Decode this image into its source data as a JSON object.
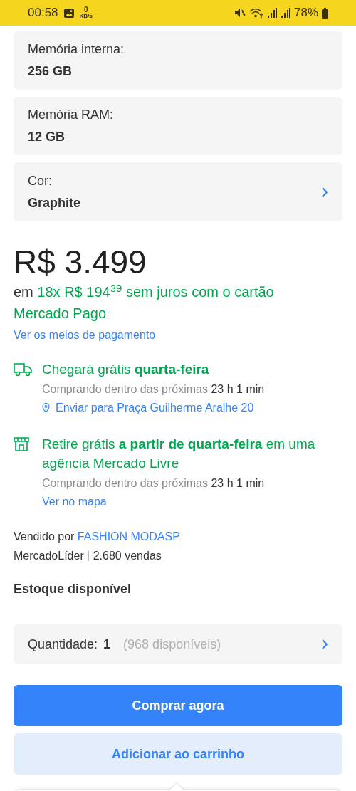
{
  "status_bar": {
    "time": "00:58",
    "speed_value": "0",
    "speed_unit": "KB/s",
    "battery": "78%"
  },
  "specs": [
    {
      "kind": "info",
      "label": "Memória interna:",
      "value": "256 GB"
    },
    {
      "kind": "info",
      "label": "Memória RAM:",
      "value": "12 GB"
    },
    {
      "kind": "select",
      "label": "Cor:",
      "value": "Graphite"
    }
  ],
  "price": "R$ 3.499",
  "installments": {
    "prefix": "em",
    "text": "18x R$ 194$^{39}$ sem juros com o cartão Mercado Pago"
  },
  "payment_link": "Ver os meios de pagamento",
  "delivery": [
    {
      "kind": "shipping",
      "title": "Chegará grátis **quarta-feira**",
      "note": "Comprando dentro das próximas",
      "time": "23 h 1 min",
      "link": "Enviar para Praça Guilherme Aralhe 20"
    },
    {
      "kind": "pickup",
      "title": "Retire grátis **a partir de quarta-feira** em uma agência Mercado Livre",
      "note": "Comprando dentro das próximas",
      "time": "23 h 1 min",
      "link": "Ver no mapa"
    }
  ],
  "seller": {
    "prefix": "Vendido por",
    "name": "FASHION MODASP",
    "badge": "MercadoLíder",
    "sales": "2.680 vendas"
  },
  "stock_title": "Estoque disponível",
  "quantity": {
    "label": "Quantidade:",
    "value": "1",
    "available": "(968 disponíveis)"
  },
  "buttons": [
    {
      "kind": "primary",
      "label": "Comprar agora"
    },
    {
      "kind": "secondary",
      "label": "Adicionar ao carrinho"
    }
  ]
}
